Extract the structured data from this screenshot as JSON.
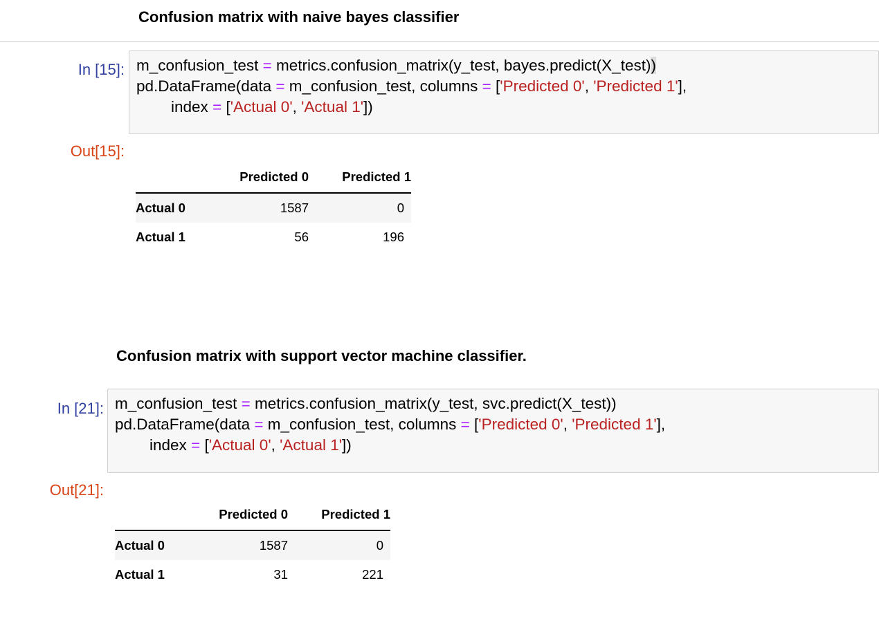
{
  "cells": [
    {
      "heading": "Confusion matrix with naive bayes classifier",
      "in_prompt": "In [15]:",
      "out_prompt": "Out[15]:",
      "code_lines": [
        [
          {
            "t": "m_confusion_test ",
            "k": "plain"
          },
          {
            "t": "=",
            "k": "op"
          },
          {
            "t": " metrics.confusion_matrix(y_test, bayes.predict(X_test)",
            "k": "plain"
          },
          {
            "t": ")",
            "k": "cursor"
          }
        ],
        [
          {
            "t": "pd.DataFrame(data ",
            "k": "plain"
          },
          {
            "t": "=",
            "k": "op"
          },
          {
            "t": " m_confusion_test, columns ",
            "k": "plain"
          },
          {
            "t": "=",
            "k": "op"
          },
          {
            "t": " [",
            "k": "plain"
          },
          {
            "t": "'Predicted 0'",
            "k": "str"
          },
          {
            "t": ", ",
            "k": "plain"
          },
          {
            "t": "'Predicted 1'",
            "k": "str"
          },
          {
            "t": "],",
            "k": "plain"
          }
        ],
        [
          {
            "t": "        index ",
            "k": "plain"
          },
          {
            "t": "=",
            "k": "op"
          },
          {
            "t": " [",
            "k": "plain"
          },
          {
            "t": "'Actual 0'",
            "k": "str"
          },
          {
            "t": ", ",
            "k": "plain"
          },
          {
            "t": "'Actual 1'",
            "k": "str"
          },
          {
            "t": "])",
            "k": "plain"
          }
        ]
      ],
      "table": {
        "columns": [
          "Predicted 0",
          "Predicted 1"
        ],
        "rows": [
          {
            "index": "Actual 0",
            "values": [
              "1587",
              "0"
            ]
          },
          {
            "index": "Actual 1",
            "values": [
              "56",
              "196"
            ]
          }
        ]
      }
    },
    {
      "heading": "Confusion matrix with support vector machine classifier.",
      "in_prompt": "In [21]:",
      "out_prompt": "Out[21]:",
      "code_lines": [
        [
          {
            "t": "m_confusion_test ",
            "k": "plain"
          },
          {
            "t": "=",
            "k": "op"
          },
          {
            "t": " metrics.confusion_matrix(y_test, svc.predict(X_test))",
            "k": "plain"
          }
        ],
        [
          {
            "t": "pd.DataFrame(data ",
            "k": "plain"
          },
          {
            "t": "=",
            "k": "op"
          },
          {
            "t": " m_confusion_test, columns ",
            "k": "plain"
          },
          {
            "t": "=",
            "k": "op"
          },
          {
            "t": " [",
            "k": "plain"
          },
          {
            "t": "'Predicted 0'",
            "k": "str"
          },
          {
            "t": ", ",
            "k": "plain"
          },
          {
            "t": "'Predicted 1'",
            "k": "str"
          },
          {
            "t": "],",
            "k": "plain"
          }
        ],
        [
          {
            "t": "        index ",
            "k": "plain"
          },
          {
            "t": "=",
            "k": "op"
          },
          {
            "t": " [",
            "k": "plain"
          },
          {
            "t": "'Actual 0'",
            "k": "str"
          },
          {
            "t": ", ",
            "k": "plain"
          },
          {
            "t": "'Actual 1'",
            "k": "str"
          },
          {
            "t": "])",
            "k": "plain"
          }
        ]
      ],
      "table": {
        "columns": [
          "Predicted 0",
          "Predicted 1"
        ],
        "rows": [
          {
            "index": "Actual 0",
            "values": [
              "1587",
              "0"
            ]
          },
          {
            "index": "Actual 1",
            "values": [
              "31",
              "221"
            ]
          }
        ]
      }
    }
  ],
  "colors": {
    "in_prompt": "#303f9f",
    "out_prompt": "#d84315",
    "operator": "#aa22ff",
    "string": "#ba2121",
    "code_background": "#f7f7f7"
  }
}
